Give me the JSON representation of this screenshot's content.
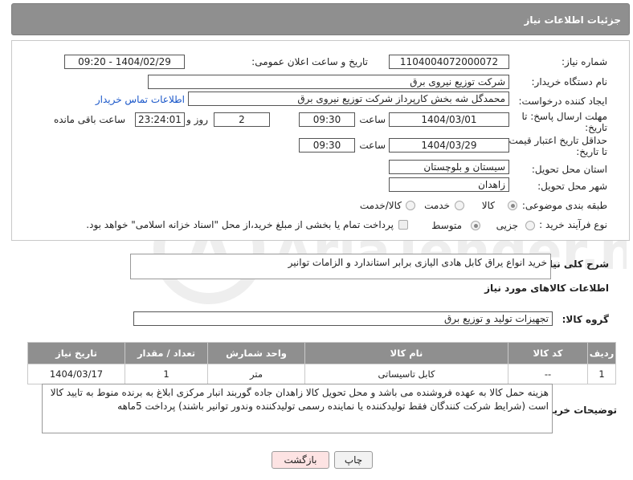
{
  "header": {
    "title": "جزئیات اطلاعات نیاز"
  },
  "form": {
    "need_number_label": "شماره نیاز:",
    "need_number": "1104004072000072",
    "announce_label": "تاریخ و ساعت اعلان عمومی:",
    "announce_value": "1404/02/29 - 09:20",
    "buyer_org_label": "نام دستگاه خریدار:",
    "buyer_org": "شرکت توزیع نیروی برق",
    "creator_label": "ایجاد کننده درخواست:",
    "creator": "محمدگل شه بخش کارپرداز شرکت توزیع نیروی برق",
    "contact_link": "اطلاعات تماس خریدار",
    "deadline_label_1": "مهلت ارسال پاسخ: تا",
    "deadline_label_2": "تاریخ:",
    "deadline_date": "1404/03/01",
    "time_label": "ساعت",
    "deadline_time": "09:30",
    "days_value": "2",
    "days_label": "روز و",
    "remaining_time": "23:24:01",
    "remaining_label": "ساعت باقی مانده",
    "validity_label_1": "حداقل تاریخ اعتبار قیمت:",
    "validity_label_2": "تا تاریخ:",
    "validity_date": "1404/03/29",
    "validity_time": "09:30",
    "province_label": "استان محل تحویل:",
    "province": "سیستان و بلوچستان",
    "city_label": "شهر محل تحویل:",
    "city": "زاهدان",
    "category_label": "طبقه بندی موضوعی:",
    "category_options": [
      "کالا",
      "خدمت",
      "کالا/خدمت"
    ],
    "category_selected": "کالا",
    "process_label": "نوع فرآیند خرید :",
    "process_options": [
      "جزیی",
      "متوسط"
    ],
    "process_selected": "متوسط",
    "payment_note": "پرداخت تمام یا بخشی از مبلغ خرید،از محل \"اسناد خزانه اسلامی\" خواهد بود."
  },
  "description": {
    "label": "شرح کلی نیاز:",
    "text": "خرید انواع یراق کابل هادی الیازی برابر استاندارد و الزامات توانیر"
  },
  "goods_section": {
    "title": "اطلاعات کالاهای مورد نیاز",
    "group_label": "گروه کالا:",
    "group_value": "تجهیزات تولید و توزیع برق"
  },
  "table": {
    "headers": [
      "ردیف",
      "کد کالا",
      "نام کالا",
      "واحد شمارش",
      "تعداد / مقدار",
      "تاریخ نیاز"
    ],
    "rows": [
      [
        "1",
        "--",
        "کابل تاسیساتی",
        "متر",
        "1",
        "1404/03/17"
      ]
    ]
  },
  "buyer_notes": {
    "label": "توضیحات خریدار:",
    "text": "هزینه حمل کالا به عهده فروشنده می باشد و محل تحویل کالا زاهدان جاده گوربند انبار مرکزی ابلاغ به برنده منوط به تایید کالا است (شرایط شرکت کنندگان فقط تولیدکننده یا نماینده رسمی تولیدکننده وندور توانیر باشند) پرداخت 5ماهه"
  },
  "buttons": {
    "print": "چاپ",
    "back": "بازگشت"
  },
  "colors": {
    "header_bg": "#8f8f8f",
    "link": "#1a57c9",
    "back_btn_bg": "#fde3e3"
  }
}
